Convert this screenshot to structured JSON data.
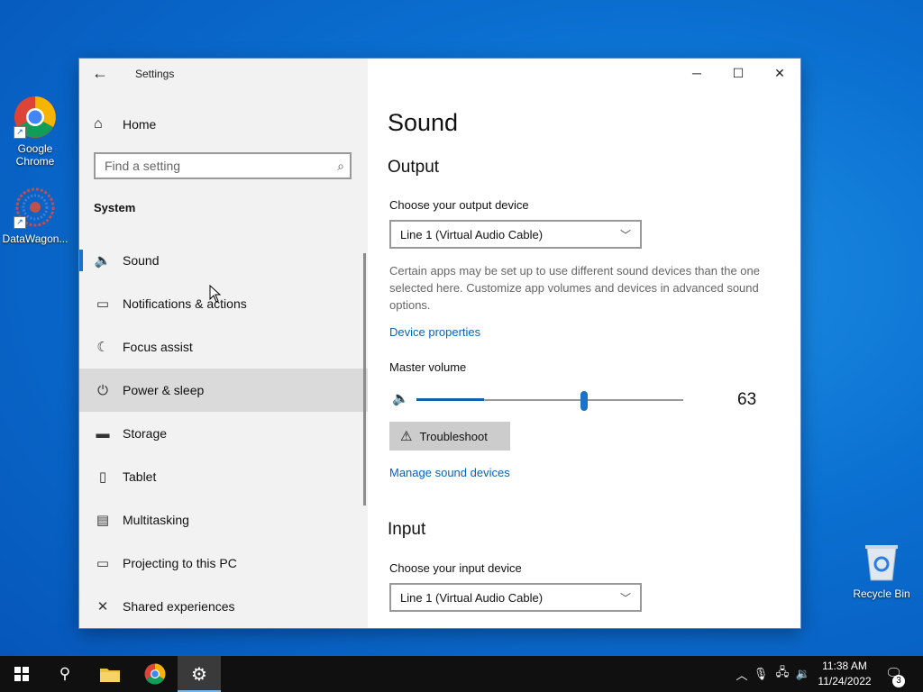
{
  "desktop": {
    "icons": [
      {
        "label": "Google Chrome"
      },
      {
        "label": "DataWagon..."
      }
    ],
    "recycle_bin": "Recycle Bin"
  },
  "window": {
    "title": "Settings",
    "controls": {
      "minimize": "─",
      "maximize": "☐",
      "close": "✕"
    }
  },
  "sidebar": {
    "home": "Home",
    "search_placeholder": "Find a setting",
    "section": "System",
    "items": [
      {
        "label": "Sound",
        "icon": "speaker-icon",
        "glyph": "🔈"
      },
      {
        "label": "Notifications & actions",
        "icon": "notification-icon",
        "glyph": "▭"
      },
      {
        "label": "Focus assist",
        "icon": "moon-icon",
        "glyph": "☾"
      },
      {
        "label": "Power & sleep",
        "icon": "power-icon",
        "glyph": "⏻"
      },
      {
        "label": "Storage",
        "icon": "storage-icon",
        "glyph": "▬"
      },
      {
        "label": "Tablet",
        "icon": "tablet-icon",
        "glyph": "▯"
      },
      {
        "label": "Multitasking",
        "icon": "multitasking-icon",
        "glyph": "▤"
      },
      {
        "label": "Projecting to this PC",
        "icon": "projecting-icon",
        "glyph": "▭"
      },
      {
        "label": "Shared experiences",
        "icon": "shared-experiences-icon",
        "glyph": "✕"
      }
    ]
  },
  "content": {
    "title": "Sound",
    "output": {
      "heading": "Output",
      "device_label": "Choose your output device",
      "device_value": "Line 1 (Virtual Audio Cable)",
      "description": "Certain apps may be set up to use different sound devices than the one selected here. Customize app volumes and devices in advanced sound options.",
      "device_properties": "Device properties",
      "master_volume_label": "Master volume",
      "volume": 63,
      "volume_text": "63",
      "troubleshoot": "Troubleshoot",
      "manage_devices": "Manage sound devices"
    },
    "input": {
      "heading": "Input",
      "device_label": "Choose your input device",
      "device_value": "Line 1 (Virtual Audio Cable)"
    }
  },
  "taskbar": {
    "time": "11:38 AM",
    "date": "11/24/2022",
    "notification_count": "3"
  }
}
